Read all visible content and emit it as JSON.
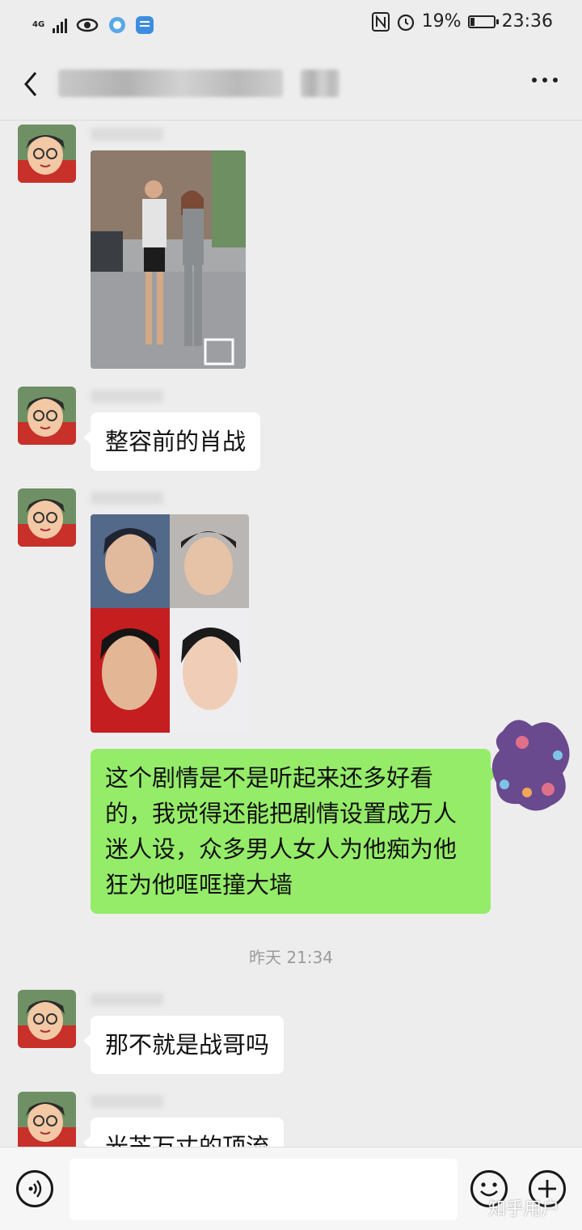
{
  "status_bar": {
    "network": "4G",
    "signal_bars": 4,
    "icons": [
      "eye-icon",
      "browser-icon",
      "zhihu-app-icon",
      "nfc-icon",
      "alarm-icon"
    ],
    "battery_percent": "19%",
    "battery_level": 0.19,
    "time": "23:36"
  },
  "header": {
    "back_icon": "chevron-left-icon",
    "title_blurred": true,
    "more_icon": "more-dots-icon"
  },
  "messages": [
    {
      "side": "left",
      "kind": "image",
      "image": "photo-couple-walking-street"
    },
    {
      "side": "left",
      "kind": "text",
      "text": "整容前的肖战"
    },
    {
      "side": "left",
      "kind": "image",
      "image": "photo-collage-four-faces"
    },
    {
      "side": "right",
      "kind": "text",
      "text": "这个剧情是不是听起来还多好看的，我觉得还能把剧情设置成万人迷人设，众多男人女人为他痴为他狂为他哐哐撞大墙"
    },
    {
      "kind": "timestamp",
      "text": "昨天 21:34"
    },
    {
      "side": "left",
      "kind": "text",
      "text": "那不就是战哥吗"
    },
    {
      "side": "left",
      "kind": "text",
      "text": "光芒万丈的顶流"
    }
  ],
  "input_bar": {
    "voice_icon": "voice-icon",
    "emoji_icon": "emoji-icon",
    "add_icon": "plus-icon",
    "placeholder": ""
  },
  "watermark": "知乎用户",
  "colors": {
    "background": "#ededed",
    "bubble_left": "#ffffff",
    "bubble_right": "#95ec69",
    "timestamp": "#9b9b9b"
  }
}
